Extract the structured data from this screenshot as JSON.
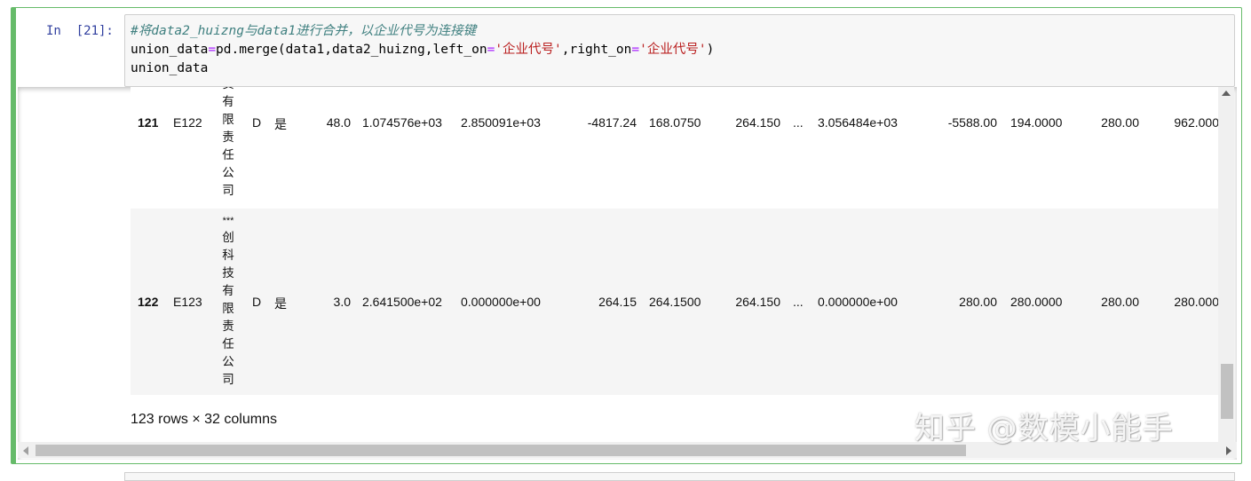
{
  "cell": {
    "prompt": "In  [21]:",
    "code": {
      "comment": "#将data2_huizng与data1进行合并，以企业代号为连接键",
      "line2_var": "union_data",
      "line2_eq": "=",
      "line2_call": "pd.merge(data1,data2_huizng,left_on",
      "line2_eq2": "=",
      "line2_str1": "'企业代号'",
      "line2_mid": ",right_on",
      "line2_eq3": "=",
      "line2_str2": "'企业代号'",
      "line2_end": ")",
      "line3": "union_data"
    }
  },
  "table": {
    "rows": [
      {
        "index": "121",
        "code": "E122",
        "name_chars": [
          "责",
          "有",
          "限",
          "责",
          "任",
          "公",
          "司"
        ],
        "rating": "D",
        "flag": "是",
        "v1": "48.0",
        "v2": "1.074576e+03",
        "v3": "2.850091e+03",
        "v4": "-4817.24",
        "v5": "168.0750",
        "v6": "264.150",
        "ellipsis": "...",
        "v7": "3.056484e+03",
        "v8": "-5588.00",
        "v9": "194.0000",
        "v10": "280.00",
        "v11": "962.000"
      },
      {
        "index": "122",
        "code": "E123",
        "name_chars": [
          "***",
          "创",
          "科",
          "技",
          "有",
          "限",
          "责",
          "任",
          "公",
          "司"
        ],
        "rating": "D",
        "flag": "是",
        "v1": "3.0",
        "v2": "2.641500e+02",
        "v3": "0.000000e+00",
        "v4": "264.15",
        "v5": "264.1500",
        "v6": "264.150",
        "ellipsis": "...",
        "v7": "0.000000e+00",
        "v8": "280.00",
        "v9": "280.0000",
        "v10": "280.00",
        "v11": "280.000"
      }
    ],
    "footer": "123 rows × 32 columns"
  },
  "watermark": "知乎 @数模小能手",
  "colors": {
    "cell_border": "#66bb6a",
    "prompt": "#303f9f",
    "comment": "#408080",
    "string": "#ba2121",
    "operator": "#aa22ff"
  }
}
